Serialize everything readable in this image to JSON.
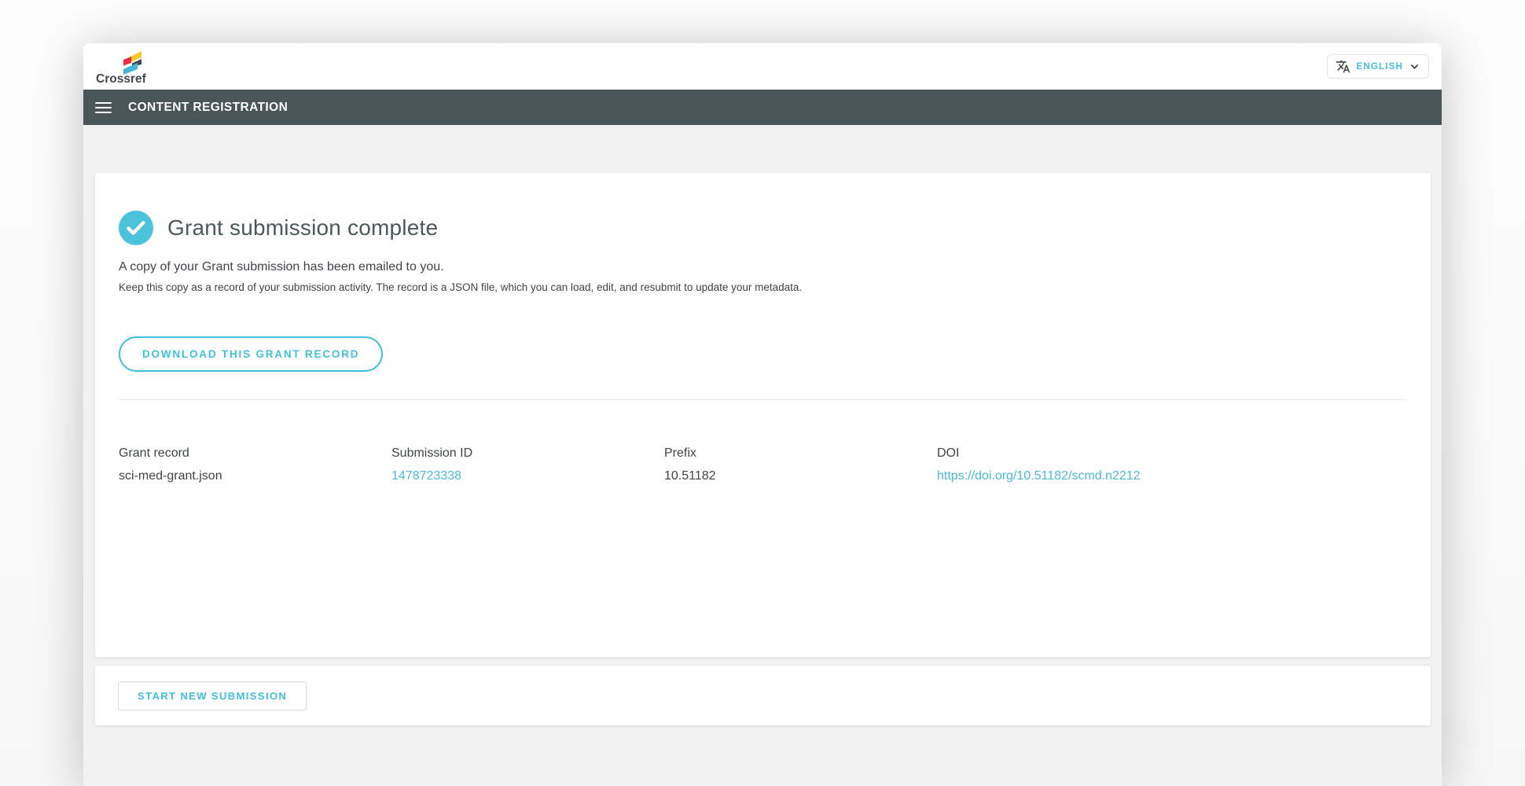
{
  "brand": {
    "name": "Crossref"
  },
  "language": {
    "label": "ENGLISH"
  },
  "nav": {
    "title": "CONTENT REGISTRATION"
  },
  "main": {
    "heading": "Grant submission complete",
    "message_primary": "A copy of your Grant submission has been emailed to you.",
    "message_secondary": "Keep this copy as a record of your submission activity. The record is a JSON file, which you can load, edit, and resubmit to update your metadata.",
    "download_button": "DOWNLOAD THIS GRANT RECORD",
    "fields": [
      {
        "label": "Grant record",
        "value": "sci-med-grant.json"
      },
      {
        "label": "Submission ID",
        "value": "1478723338"
      },
      {
        "label": "Prefix",
        "value": "10.51182"
      },
      {
        "label": "DOI",
        "value": "https://doi.org/10.51182/scmd.n2212"
      }
    ]
  },
  "footer": {
    "start_button": "START NEW SUBMISSION"
  },
  "colors": {
    "accent_cyan": "#41c0e2",
    "link_cyan": "#4bb8d6",
    "check_circle": "#4bc3da",
    "nav_bg": "#4a5557",
    "logo_yellow": "#ffc72c",
    "logo_red": "#ee2b43",
    "logo_dark": "#3f4848",
    "logo_teal": "#45b6d3"
  }
}
